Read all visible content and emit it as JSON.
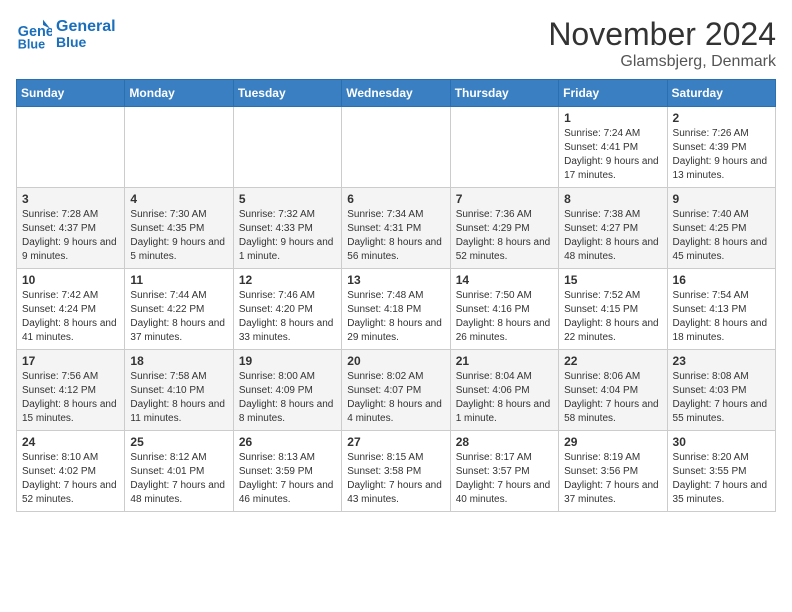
{
  "header": {
    "logo_line1": "General",
    "logo_line2": "Blue",
    "month": "November 2024",
    "location": "Glamsbjerg, Denmark"
  },
  "weekdays": [
    "Sunday",
    "Monday",
    "Tuesday",
    "Wednesday",
    "Thursday",
    "Friday",
    "Saturday"
  ],
  "weeks": [
    [
      {
        "day": "",
        "info": ""
      },
      {
        "day": "",
        "info": ""
      },
      {
        "day": "",
        "info": ""
      },
      {
        "day": "",
        "info": ""
      },
      {
        "day": "",
        "info": ""
      },
      {
        "day": "1",
        "info": "Sunrise: 7:24 AM\nSunset: 4:41 PM\nDaylight: 9 hours and 17 minutes."
      },
      {
        "day": "2",
        "info": "Sunrise: 7:26 AM\nSunset: 4:39 PM\nDaylight: 9 hours and 13 minutes."
      }
    ],
    [
      {
        "day": "3",
        "info": "Sunrise: 7:28 AM\nSunset: 4:37 PM\nDaylight: 9 hours and 9 minutes."
      },
      {
        "day": "4",
        "info": "Sunrise: 7:30 AM\nSunset: 4:35 PM\nDaylight: 9 hours and 5 minutes."
      },
      {
        "day": "5",
        "info": "Sunrise: 7:32 AM\nSunset: 4:33 PM\nDaylight: 9 hours and 1 minute."
      },
      {
        "day": "6",
        "info": "Sunrise: 7:34 AM\nSunset: 4:31 PM\nDaylight: 8 hours and 56 minutes."
      },
      {
        "day": "7",
        "info": "Sunrise: 7:36 AM\nSunset: 4:29 PM\nDaylight: 8 hours and 52 minutes."
      },
      {
        "day": "8",
        "info": "Sunrise: 7:38 AM\nSunset: 4:27 PM\nDaylight: 8 hours and 48 minutes."
      },
      {
        "day": "9",
        "info": "Sunrise: 7:40 AM\nSunset: 4:25 PM\nDaylight: 8 hours and 45 minutes."
      }
    ],
    [
      {
        "day": "10",
        "info": "Sunrise: 7:42 AM\nSunset: 4:24 PM\nDaylight: 8 hours and 41 minutes."
      },
      {
        "day": "11",
        "info": "Sunrise: 7:44 AM\nSunset: 4:22 PM\nDaylight: 8 hours and 37 minutes."
      },
      {
        "day": "12",
        "info": "Sunrise: 7:46 AM\nSunset: 4:20 PM\nDaylight: 8 hours and 33 minutes."
      },
      {
        "day": "13",
        "info": "Sunrise: 7:48 AM\nSunset: 4:18 PM\nDaylight: 8 hours and 29 minutes."
      },
      {
        "day": "14",
        "info": "Sunrise: 7:50 AM\nSunset: 4:16 PM\nDaylight: 8 hours and 26 minutes."
      },
      {
        "day": "15",
        "info": "Sunrise: 7:52 AM\nSunset: 4:15 PM\nDaylight: 8 hours and 22 minutes."
      },
      {
        "day": "16",
        "info": "Sunrise: 7:54 AM\nSunset: 4:13 PM\nDaylight: 8 hours and 18 minutes."
      }
    ],
    [
      {
        "day": "17",
        "info": "Sunrise: 7:56 AM\nSunset: 4:12 PM\nDaylight: 8 hours and 15 minutes."
      },
      {
        "day": "18",
        "info": "Sunrise: 7:58 AM\nSunset: 4:10 PM\nDaylight: 8 hours and 11 minutes."
      },
      {
        "day": "19",
        "info": "Sunrise: 8:00 AM\nSunset: 4:09 PM\nDaylight: 8 hours and 8 minutes."
      },
      {
        "day": "20",
        "info": "Sunrise: 8:02 AM\nSunset: 4:07 PM\nDaylight: 8 hours and 4 minutes."
      },
      {
        "day": "21",
        "info": "Sunrise: 8:04 AM\nSunset: 4:06 PM\nDaylight: 8 hours and 1 minute."
      },
      {
        "day": "22",
        "info": "Sunrise: 8:06 AM\nSunset: 4:04 PM\nDaylight: 7 hours and 58 minutes."
      },
      {
        "day": "23",
        "info": "Sunrise: 8:08 AM\nSunset: 4:03 PM\nDaylight: 7 hours and 55 minutes."
      }
    ],
    [
      {
        "day": "24",
        "info": "Sunrise: 8:10 AM\nSunset: 4:02 PM\nDaylight: 7 hours and 52 minutes."
      },
      {
        "day": "25",
        "info": "Sunrise: 8:12 AM\nSunset: 4:01 PM\nDaylight: 7 hours and 48 minutes."
      },
      {
        "day": "26",
        "info": "Sunrise: 8:13 AM\nSunset: 3:59 PM\nDaylight: 7 hours and 46 minutes."
      },
      {
        "day": "27",
        "info": "Sunrise: 8:15 AM\nSunset: 3:58 PM\nDaylight: 7 hours and 43 minutes."
      },
      {
        "day": "28",
        "info": "Sunrise: 8:17 AM\nSunset: 3:57 PM\nDaylight: 7 hours and 40 minutes."
      },
      {
        "day": "29",
        "info": "Sunrise: 8:19 AM\nSunset: 3:56 PM\nDaylight: 7 hours and 37 minutes."
      },
      {
        "day": "30",
        "info": "Sunrise: 8:20 AM\nSunset: 3:55 PM\nDaylight: 7 hours and 35 minutes."
      }
    ]
  ]
}
